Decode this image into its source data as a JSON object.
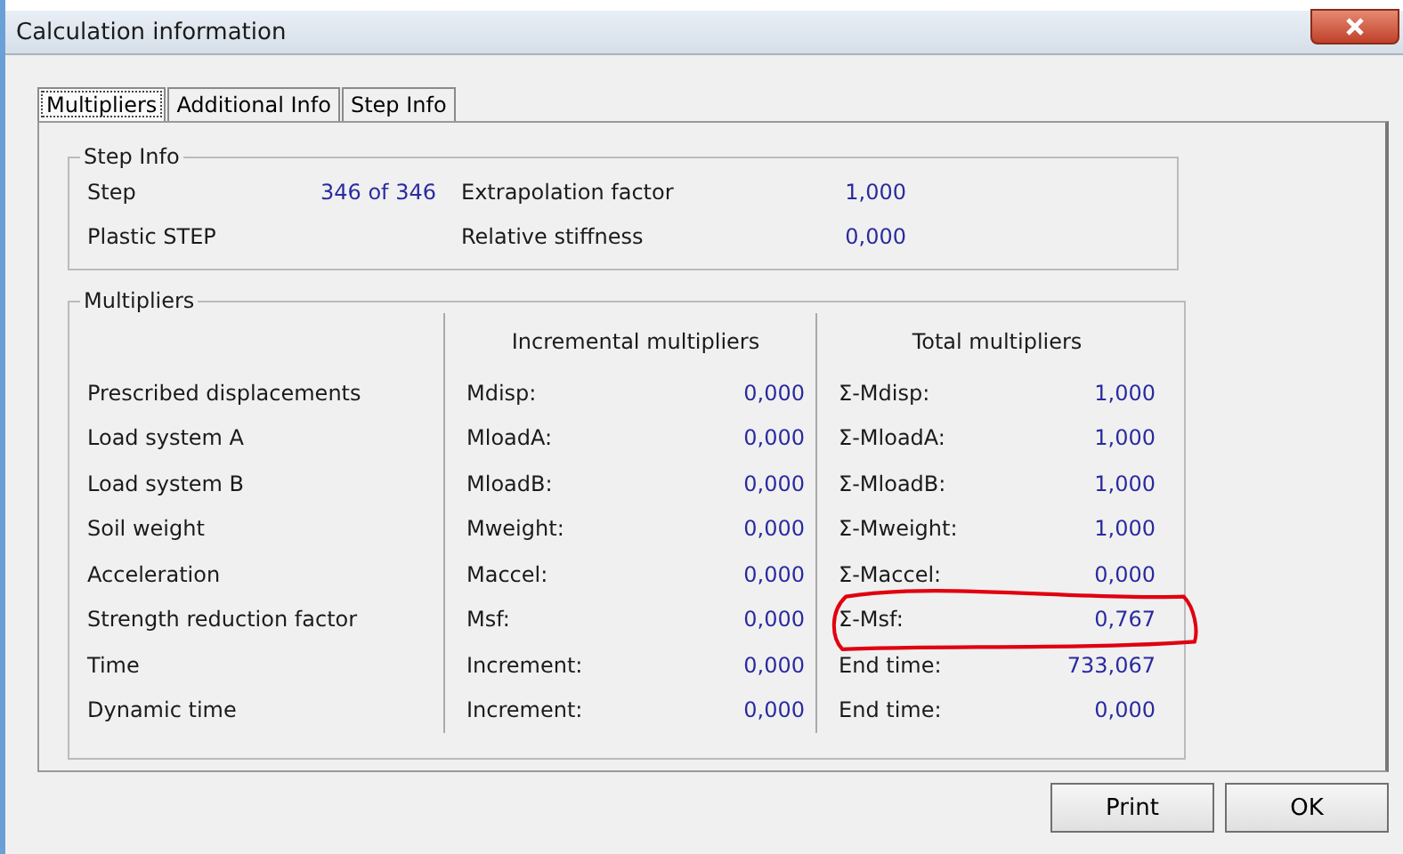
{
  "window": {
    "title": "Calculation information"
  },
  "tabs": [
    {
      "label": "Multipliers",
      "selected": true
    },
    {
      "label": "Additional Info",
      "selected": false
    },
    {
      "label": "Step Info",
      "selected": false
    }
  ],
  "step_info": {
    "title": "Step Info",
    "rows": [
      {
        "label": "Step",
        "value": "346 of 346",
        "label_2": "Extrapolation factor",
        "value_2": "1,000"
      },
      {
        "label": "Plastic STEP",
        "label_2": "Relative stiffness",
        "value_2": "0,000"
      }
    ]
  },
  "multipliers": {
    "title": "Multipliers",
    "incremental_header": "Incremental multipliers",
    "total_header": "Total multipliers",
    "rows": [
      {
        "label": "Prescribed displacements",
        "inc_label": "Mdisp:",
        "inc_value": "0,000",
        "total_label": "Σ-Mdisp:",
        "total_value": "1,000",
        "highlighted": false
      },
      {
        "label": "Load system A",
        "inc_label": "MloadA:",
        "inc_value": "0,000",
        "total_label": "Σ-MloadA:",
        "total_value": "1,000",
        "highlighted": false
      },
      {
        "label": "Load system B",
        "inc_label": "MloadB:",
        "inc_value": "0,000",
        "total_label": "Σ-MloadB:",
        "total_value": "1,000",
        "highlighted": false
      },
      {
        "label": "Soil weight",
        "inc_label": "Mweight:",
        "inc_value": "0,000",
        "total_label": "Σ-Mweight:",
        "total_value": "1,000",
        "highlighted": false
      },
      {
        "label": "Acceleration",
        "inc_label": "Maccel:",
        "inc_value": "0,000",
        "total_label": "Σ-Maccel:",
        "total_value": "0,000",
        "highlighted": false
      },
      {
        "label": "Strength reduction factor",
        "inc_label": "Msf:",
        "inc_value": "0,000",
        "total_label": "Σ-Msf:",
        "total_value": "0,767",
        "highlighted": true
      },
      {
        "label": "Time",
        "inc_label": "Increment:",
        "inc_value": "0,000",
        "total_label": "End time:",
        "total_value": "733,067",
        "highlighted": false
      },
      {
        "label": "Dynamic time",
        "inc_label": "Increment:",
        "inc_value": "0,000",
        "total_label": "End time:",
        "total_value": "0,000",
        "highlighted": false
      }
    ]
  },
  "buttons": [
    "Print",
    "OK"
  ]
}
